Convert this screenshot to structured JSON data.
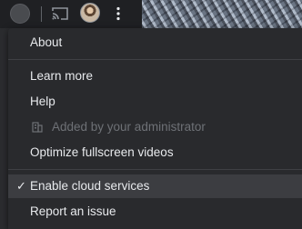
{
  "toolbar": {
    "icons": [
      "extension-icon",
      "cast-icon",
      "profile-avatar",
      "kebab-menu-icon"
    ]
  },
  "menu": {
    "about": "About",
    "learn_more": "Learn more",
    "help": "Help",
    "admin_notice": "Added by your administrator",
    "optimize": "Optimize fullscreen videos",
    "cloud": "Enable cloud services",
    "cloud_checked": true,
    "report": "Report an issue"
  },
  "colors": {
    "menu_bg": "#292a2d",
    "text": "#e8eaed",
    "disabled_text": "#6e7176",
    "highlight_bg": "#3c3d41"
  }
}
